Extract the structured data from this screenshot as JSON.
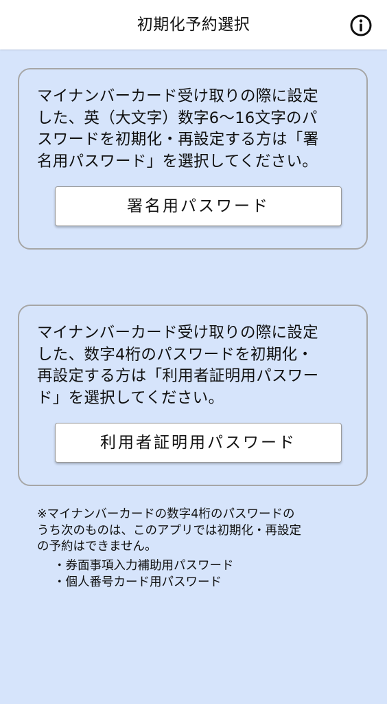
{
  "header": {
    "title": "初期化予約選択",
    "info_icon": "info-circle-icon"
  },
  "cards": [
    {
      "description": "マイナンバーカード受け取りの際に設定\nした、英（大文字）数字6～16文字のパ\nスワードを初期化・再設定する方は「署\n名用パスワード」を選択してください。",
      "button_label": "署名用パスワード"
    },
    {
      "description": "マイナンバーカード受け取りの際に設定\nした、数字4桁のパスワードを初期化・\n再設定する方は「利用者証明用パスワー\nド」を選択してください。",
      "button_label": "利用者証明用パスワード"
    }
  ],
  "note": {
    "text": "※マイナンバーカードの数字4桁のパスワードの\nうち次のものは、このアプリでは初期化・再設定\nの予約はできません。",
    "items": [
      "・券面事項入力補助用パスワード",
      "・個人番号カード用パスワード"
    ]
  },
  "colors": {
    "background": "#d6e4fb",
    "header": "#ffffff",
    "card_border": "#a6a6a6",
    "button": "#ffffff"
  }
}
